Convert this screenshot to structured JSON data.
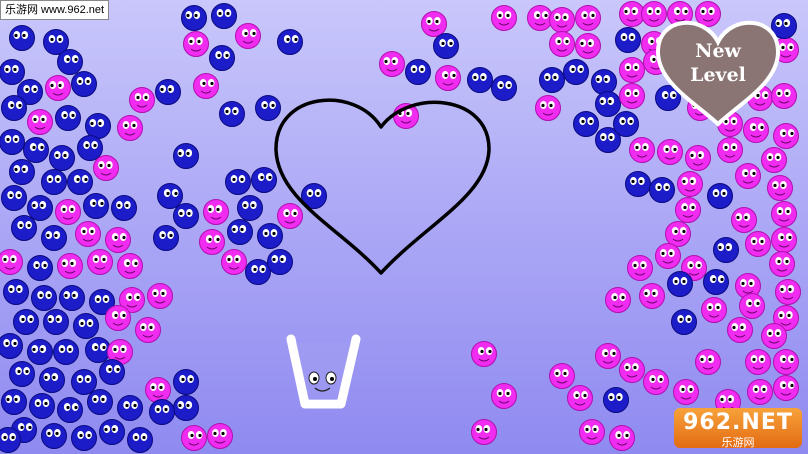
{
  "watermark_top": "乐游网 www.962.net",
  "watermark_bottom": {
    "brand": "962.NET",
    "subtitle": "乐游网"
  },
  "new_level_button": {
    "line1": "New",
    "line2": "Level",
    "color": "#8a7474"
  },
  "colors": {
    "blue_ball": "#1c1cc9",
    "pink_ball": "#f02cf0",
    "heart_outline": "#000000",
    "cup": "#ffffff"
  },
  "icons": [
    "heart-outline-icon",
    "heart-button-icon",
    "cup-character-icon",
    "blue-ball-icon",
    "pink-ball-icon"
  ]
}
